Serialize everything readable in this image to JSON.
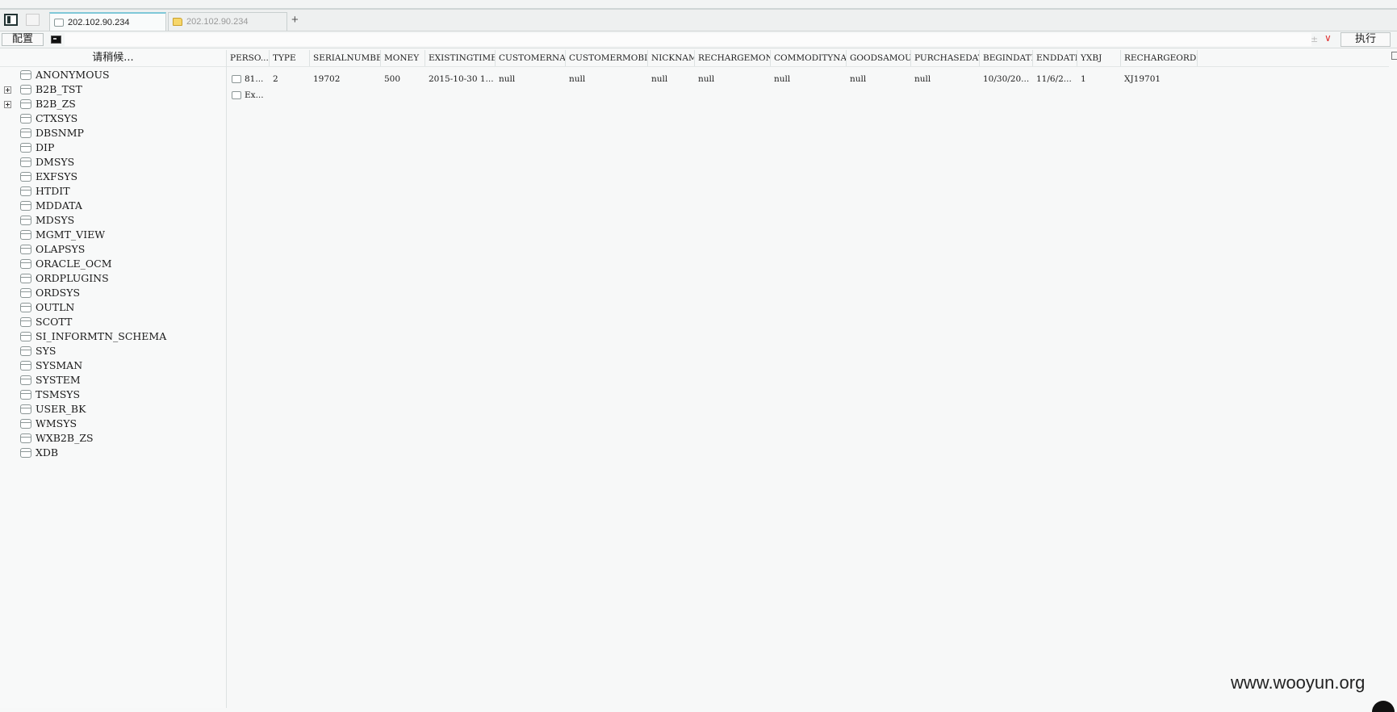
{
  "tabs": [
    {
      "label": "202.102.90.234",
      "icon": "db-tab-icon"
    },
    {
      "label": "202.102.90.234",
      "icon": "folder-icon"
    }
  ],
  "toolbar": {
    "config_label": "配置",
    "plusminus_glyph": "±",
    "chevron_glyph": "∨",
    "run_label": "执行",
    "command_value": ""
  },
  "tree": {
    "header": "请稍候...",
    "items": [
      {
        "label": "ANONYMOUS",
        "expandable": false
      },
      {
        "label": "B2B_TST",
        "expandable": true
      },
      {
        "label": "B2B_ZS",
        "expandable": true
      },
      {
        "label": "CTXSYS",
        "expandable": false
      },
      {
        "label": "DBSNMP",
        "expandable": false
      },
      {
        "label": "DIP",
        "expandable": false
      },
      {
        "label": "DMSYS",
        "expandable": false
      },
      {
        "label": "EXFSYS",
        "expandable": false
      },
      {
        "label": "HTDIT",
        "expandable": false
      },
      {
        "label": "MDDATA",
        "expandable": false
      },
      {
        "label": "MDSYS",
        "expandable": false
      },
      {
        "label": "MGMT_VIEW",
        "expandable": false
      },
      {
        "label": "OLAPSYS",
        "expandable": false
      },
      {
        "label": "ORACLE_OCM",
        "expandable": false
      },
      {
        "label": "ORDPLUGINS",
        "expandable": false
      },
      {
        "label": "ORDSYS",
        "expandable": false
      },
      {
        "label": "OUTLN",
        "expandable": false
      },
      {
        "label": "SCOTT",
        "expandable": false
      },
      {
        "label": "SI_INFORMTN_SCHEMA",
        "expandable": false
      },
      {
        "label": "SYS",
        "expandable": false
      },
      {
        "label": "SYSMAN",
        "expandable": false
      },
      {
        "label": "SYSTEM",
        "expandable": false
      },
      {
        "label": "TSMSYS",
        "expandable": false
      },
      {
        "label": "USER_BK",
        "expandable": false
      },
      {
        "label": "WMSYS",
        "expandable": false
      },
      {
        "label": "WXB2B_ZS",
        "expandable": false
      },
      {
        "label": "XDB",
        "expandable": false
      }
    ]
  },
  "grid": {
    "columns": [
      "PERSO...",
      "TYPE",
      "SERIALNUMBER",
      "MONEY",
      "EXISTINGTIME",
      "CUSTOMERNAME",
      "CUSTOMERMOBILE",
      "NICKNAME",
      "RECHARGEMONEY",
      "COMMODITYNAME",
      "GOODSAMOUNT",
      "PURCHASEDATA",
      "BEGINDATE",
      "ENDDATE",
      "YXBJ",
      "RECHARGEORDER"
    ],
    "rows": [
      [
        "81...",
        "2",
        "19702",
        "500",
        "2015-10-30 1...",
        "null",
        "null",
        "null",
        "null",
        "null",
        "null",
        "null",
        "10/30/20...",
        "11/6/2...",
        "1",
        "XJ19701"
      ],
      [
        "Ex...",
        "",
        "",
        "",
        "",
        "",
        "",
        "",
        "",
        "",
        "",
        "",
        "",
        "",
        "",
        ""
      ]
    ]
  },
  "watermark": "www.wooyun.org"
}
